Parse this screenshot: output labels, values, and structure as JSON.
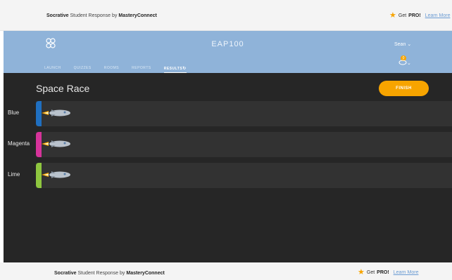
{
  "topbar": {
    "brand_strong": "Socrative",
    "brand_rest": " Student Response by ",
    "brand_company": "MasteryConnect",
    "pro_prefix": "Get ",
    "pro_label": "PRO!",
    "learn_more": "Learn More"
  },
  "header": {
    "class_name": "EAP100",
    "user": "Sean",
    "notification_count": "0",
    "nav": [
      {
        "label": "LAUNCH"
      },
      {
        "label": "QUIZZES"
      },
      {
        "label": "ROOMS"
      },
      {
        "label": "REPORTS"
      },
      {
        "label": "RESULTS"
      }
    ]
  },
  "race": {
    "title": "Space Race",
    "finish_label": "FINISH",
    "teams": [
      {
        "name": "Blue",
        "color": "#1f6fc0"
      },
      {
        "name": "Magenta",
        "color": "#d6339a"
      },
      {
        "name": "Lime",
        "color": "#8ec63f"
      }
    ]
  },
  "footer": {
    "brand_strong": "Socrative",
    "brand_rest": " Student Response by ",
    "brand_company": "MasteryConnect",
    "pro_prefix": "Get ",
    "pro_label": "PRO!",
    "learn_more": "Learn More"
  },
  "colors": {
    "accent": "#f7a400",
    "header_bg": "#8fb3d9",
    "stage_bg": "#262626"
  }
}
